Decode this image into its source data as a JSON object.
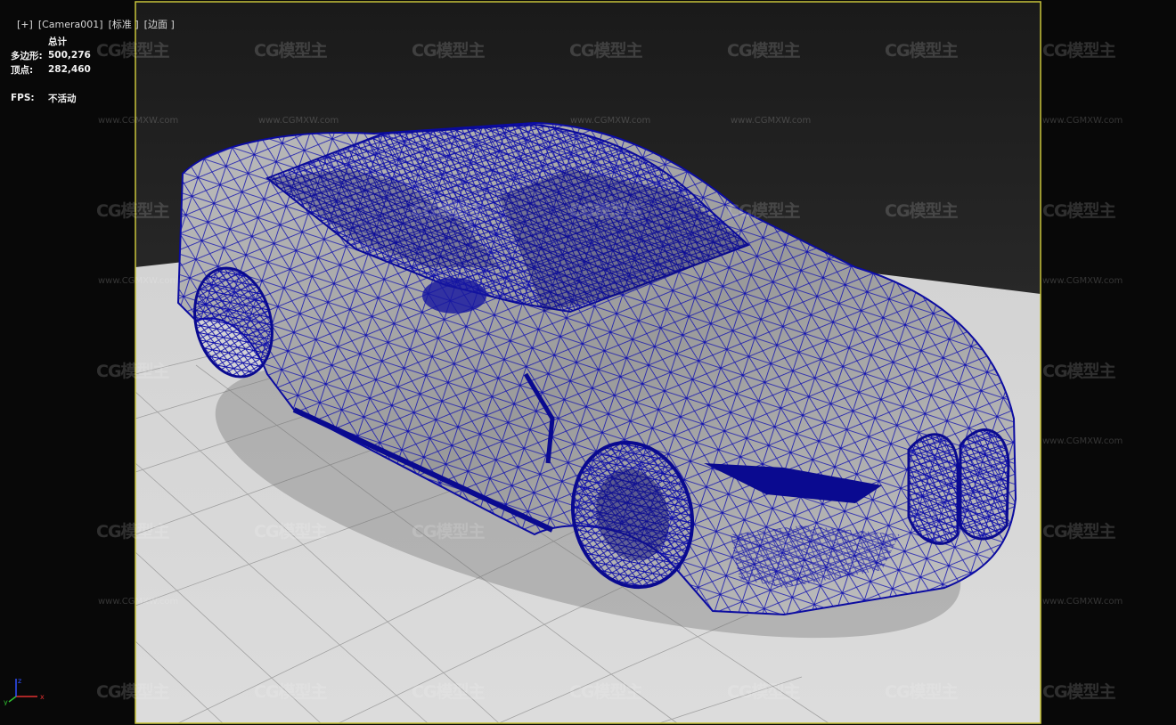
{
  "viewport": {
    "label_items": [
      "[+]",
      "[Camera001]",
      "[标准 ]",
      "[边面 ]"
    ],
    "stats": {
      "title": "总计",
      "polys_label": "多边形:",
      "polys_value": "500,276",
      "verts_label": "顶点:",
      "verts_value": "282,460",
      "fps_label": "FPS:",
      "fps_value": "不活动"
    },
    "frame_color": "#c8c43a",
    "wire_color": "#1010a8",
    "axis_labels": {
      "x": "x",
      "y": "y",
      "z": "z"
    }
  },
  "watermark": {
    "logo_text": "CG模型主",
    "url_text": "www.CGMXW.com"
  }
}
